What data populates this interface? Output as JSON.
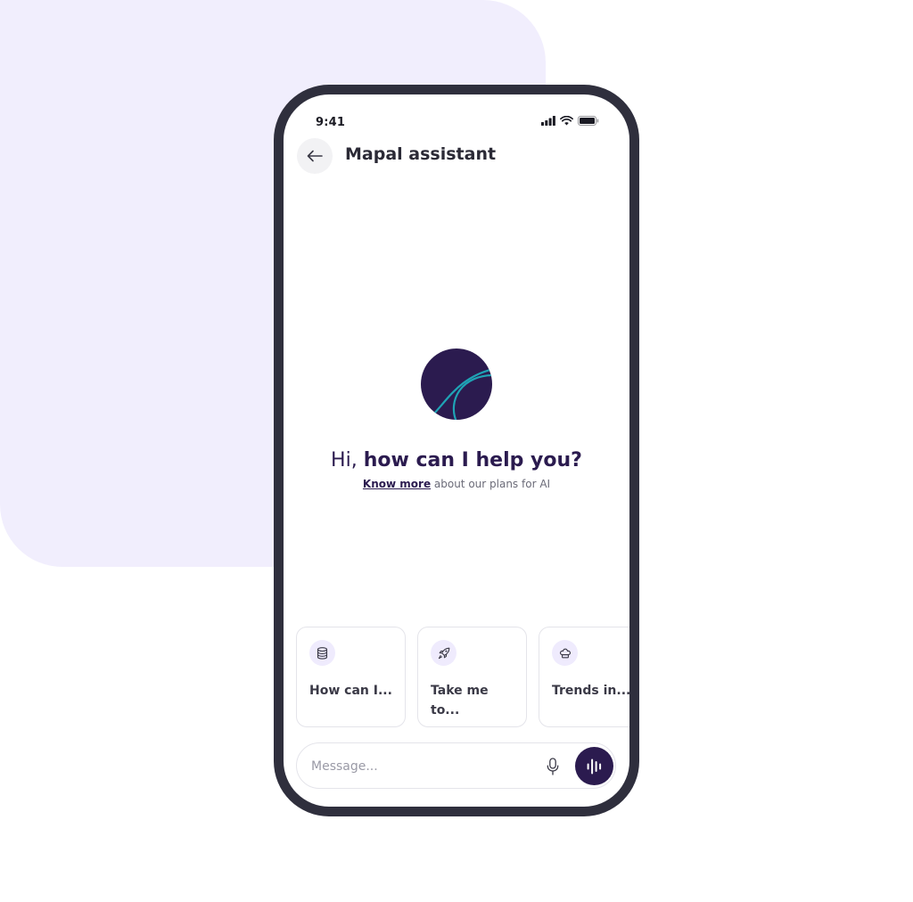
{
  "status_bar": {
    "time": "9:41",
    "icons": [
      "signal-icon",
      "wifi-icon",
      "battery-icon"
    ]
  },
  "header": {
    "back_icon": "arrow-left-icon",
    "title": "Mapal assistant"
  },
  "greeting": {
    "prefix": "Hi, ",
    "emphasis": "how can I help you?"
  },
  "info": {
    "link": "Know more",
    "rest": " about our plans for AI"
  },
  "suggestions": [
    {
      "icon": "database-icon",
      "label": "How can I..."
    },
    {
      "icon": "rocket-icon",
      "label": "Take me to..."
    },
    {
      "icon": "chef-hat-icon",
      "label": "Trends in..."
    }
  ],
  "composer": {
    "placeholder": "Message...",
    "mic_icon": "microphone-icon",
    "voice_icon": "waveform-icon"
  },
  "colors": {
    "brand": "#2b1b4f",
    "accent": "#1fa3b5",
    "background_blob": "#f1eefd",
    "device_frame": "#2f2f3d"
  }
}
